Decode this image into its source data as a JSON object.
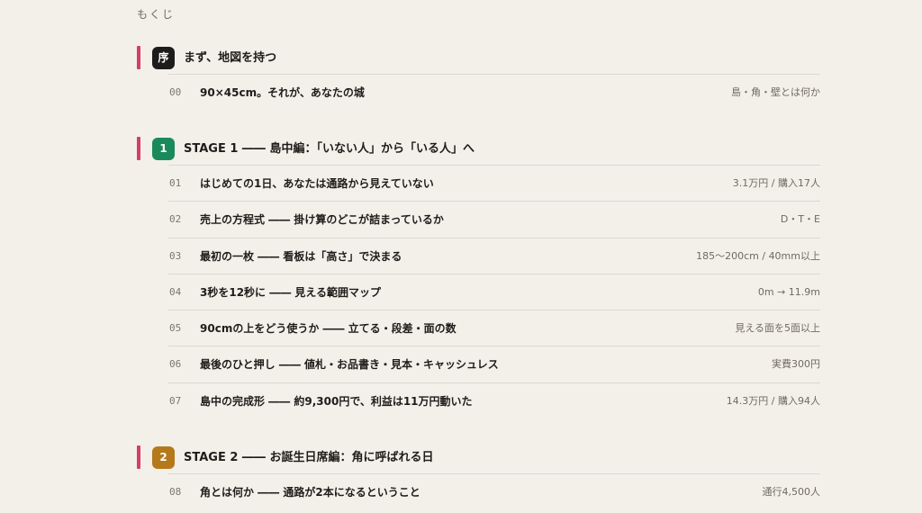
{
  "toc_heading": "もくじ",
  "colors": {
    "accent": "#d63d67",
    "badge_intro": "#1d1c1a",
    "badge_stage1": "#1b8a5a",
    "badge_stage2": "#b5791c"
  },
  "sections": [
    {
      "badge": "序",
      "title": "まず、地図を持つ",
      "items": [
        {
          "num": "00",
          "title": "90×45cm。それが、あなたの城",
          "meta": "島・角・壁とは何か"
        }
      ]
    },
    {
      "badge": "1",
      "title": "STAGE 1 ―― 島中編：「いない人」から「いる人」へ",
      "items": [
        {
          "num": "01",
          "title": "はじめての1日、あなたは通路から見えていない",
          "meta": "3.1万円 / 購入17人"
        },
        {
          "num": "02",
          "title": "売上の方程式 ―― 掛け算のどこが詰まっているか",
          "meta": "D・T・E"
        },
        {
          "num": "03",
          "title": "最初の一枚 ―― 看板は「高さ」で決まる",
          "meta": "185〜200cm / 40mm以上"
        },
        {
          "num": "04",
          "title": "3秒を12秒に ―― 見える範囲マップ",
          "meta": "0m → 11.9m"
        },
        {
          "num": "05",
          "title": "90cmの上をどう使うか ―― 立てる・段差・面の数",
          "meta": "見える面を5面以上"
        },
        {
          "num": "06",
          "title": "最後のひと押し ―― 値札・お品書き・見本・キャッシュレス",
          "meta": "実費300円"
        },
        {
          "num": "07",
          "title": "島中の完成形 ―― 約9,300円で、利益は11万円動いた",
          "meta": "14.3万円 / 購入94人"
        }
      ]
    },
    {
      "badge": "2",
      "title": "STAGE 2 ―― お誕生日席編：角に呼ばれる日",
      "items": [
        {
          "num": "08",
          "title": "角とは何か ―― 通路が2本になるということ",
          "meta": "通行4,500人"
        }
      ]
    }
  ]
}
